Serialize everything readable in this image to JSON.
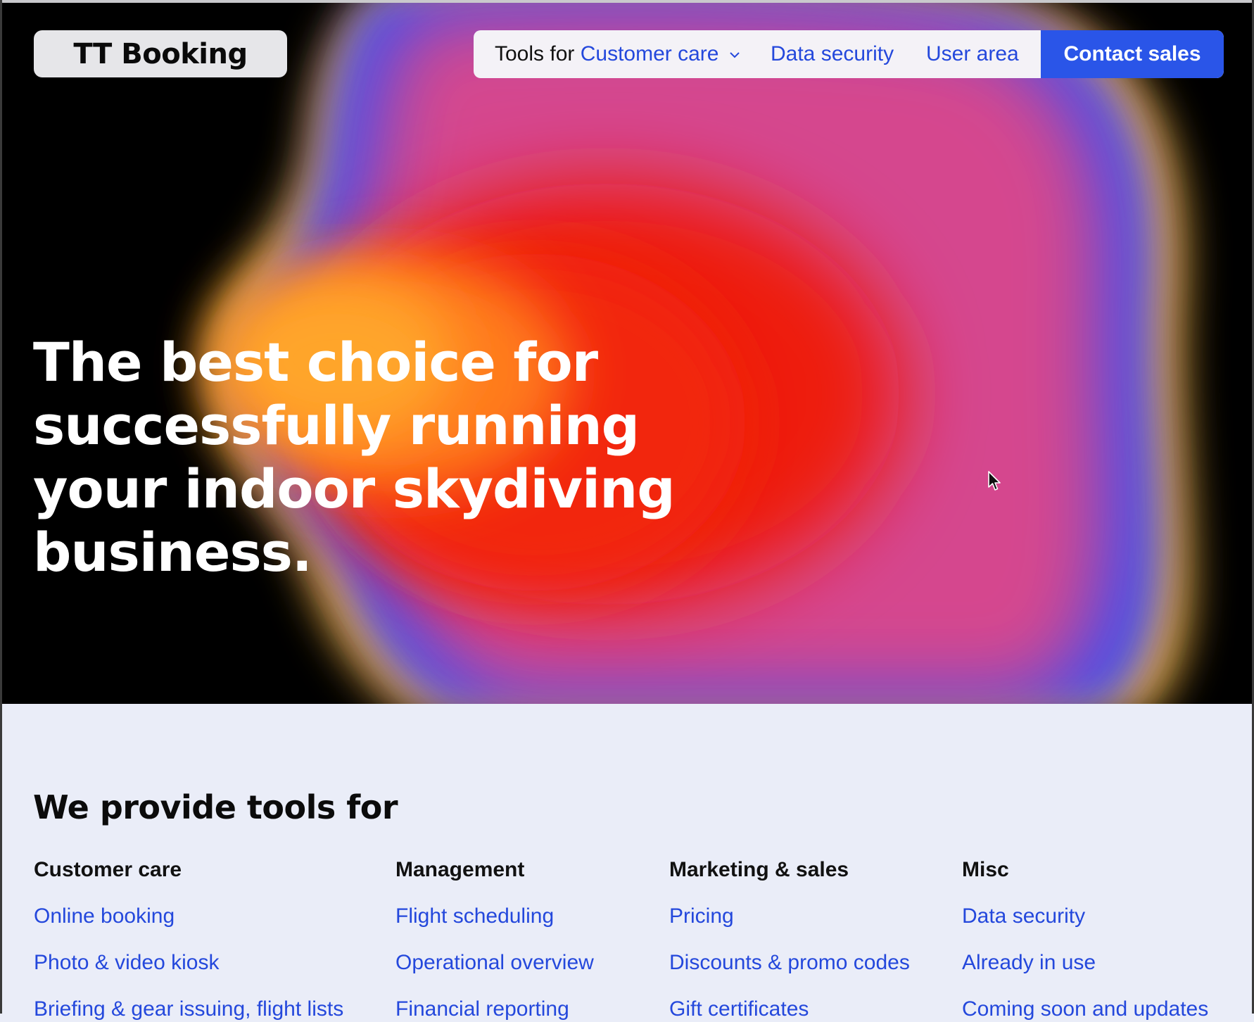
{
  "brand": {
    "logo_text": "TT Booking"
  },
  "nav": {
    "tools_prefix": "Tools for",
    "tools_value": "Customer care",
    "data_security": "Data security",
    "user_area": "User area",
    "contact_sales": "Contact sales"
  },
  "hero": {
    "headline_lines": [
      "The best choice for",
      "successfully running",
      "your indoor skydiving",
      "business."
    ]
  },
  "tools": {
    "title": "We provide tools for",
    "columns": [
      {
        "title": "Customer care",
        "links": [
          "Online booking",
          "Photo & video kiosk",
          "Briefing & gear issuing, flight lists"
        ]
      },
      {
        "title": "Management",
        "links": [
          "Flight scheduling",
          "Operational overview",
          "Financial reporting"
        ]
      },
      {
        "title": "Marketing & sales",
        "links": [
          "Pricing",
          "Discounts & promo codes",
          "Gift certificates"
        ]
      },
      {
        "title": "Misc",
        "links": [
          "Data security",
          "Already in use",
          "Coming soon and updates"
        ]
      }
    ]
  },
  "colors": {
    "link_blue": "#2448dc",
    "contact_button": "#2a55e8",
    "hero_background": "#000000",
    "section_background": "#eaedf8"
  },
  "icons": {
    "dropdown": "chevron-down-icon",
    "pointer": "mouse-cursor-icon"
  }
}
